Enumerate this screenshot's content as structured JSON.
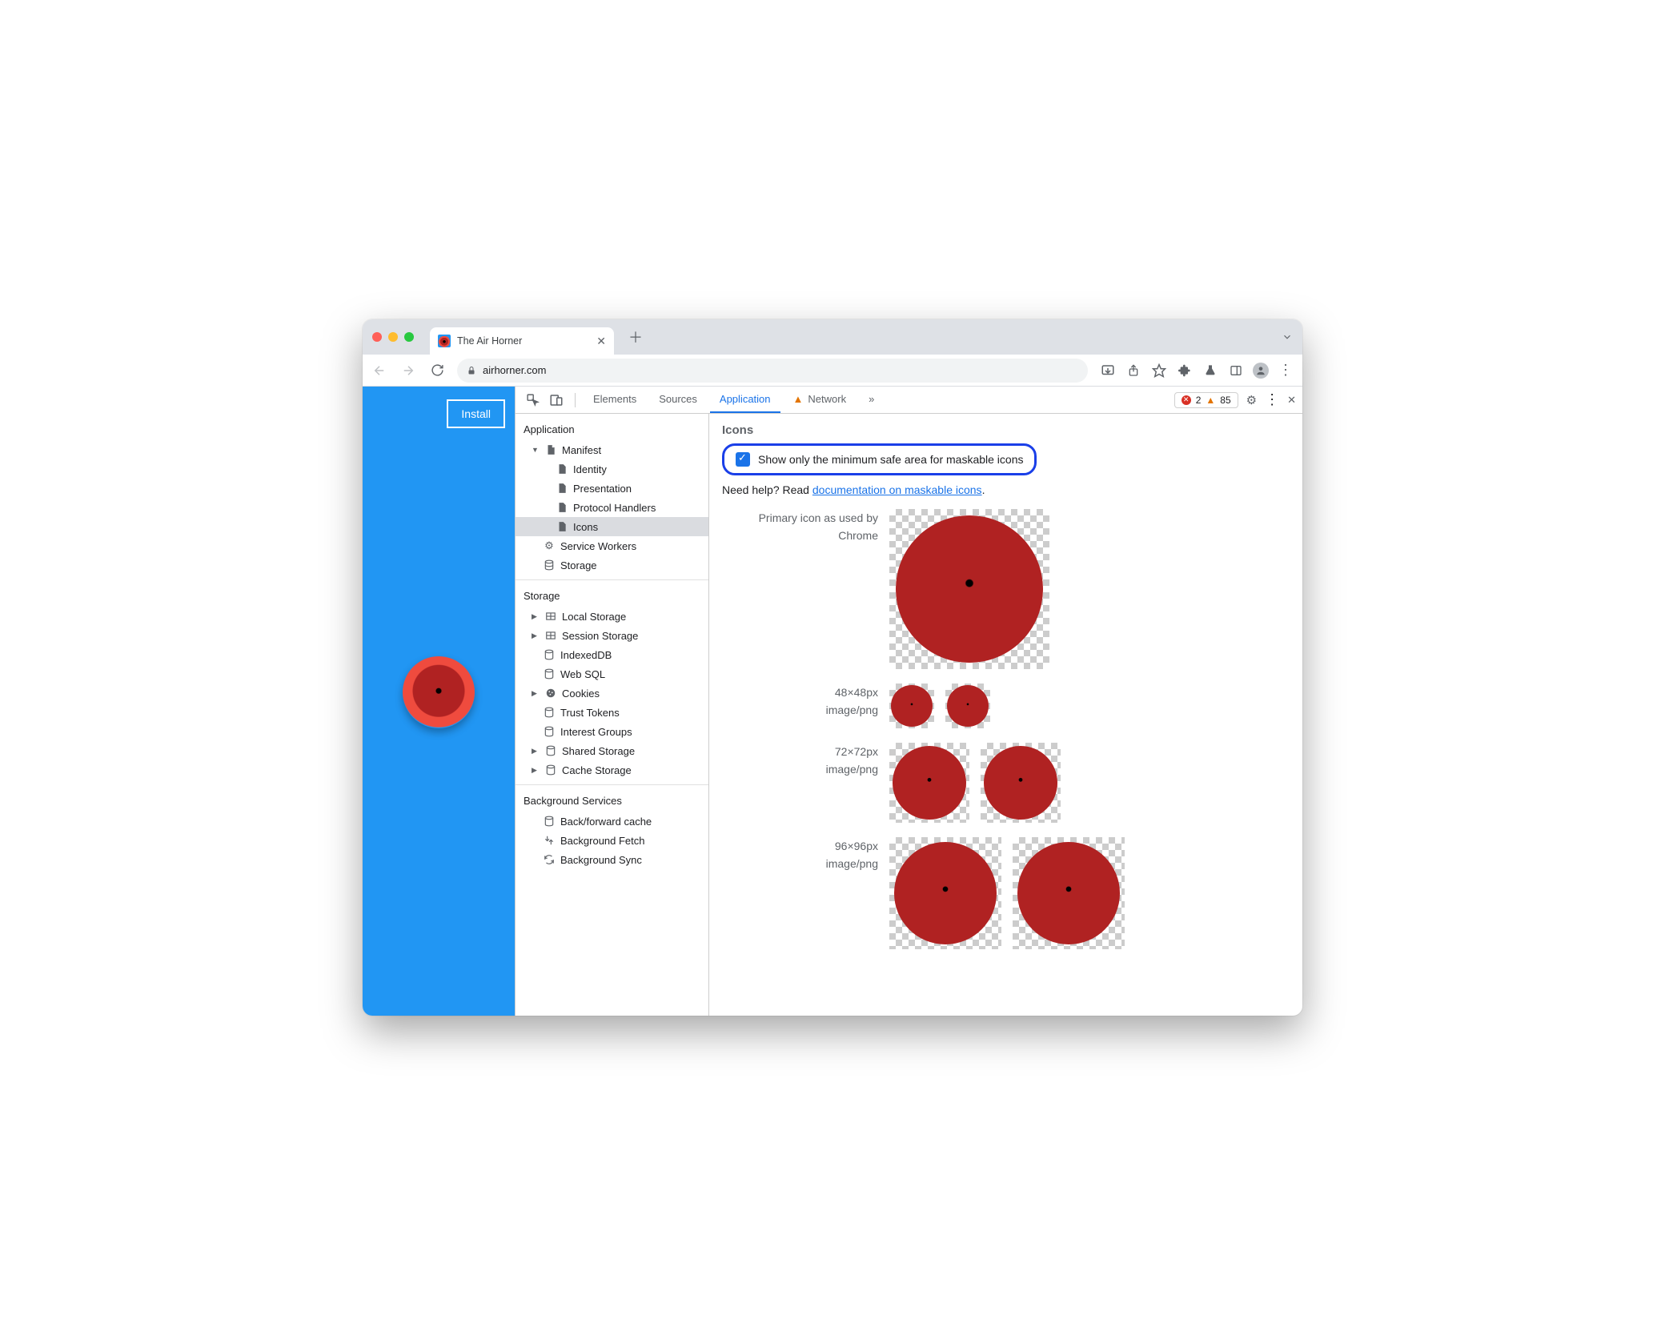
{
  "tab": {
    "title": "The Air Horner"
  },
  "omnibox": {
    "url": "airhorner.com"
  },
  "page": {
    "install_label": "Install"
  },
  "devtools": {
    "tabs": {
      "elements": "Elements",
      "sources": "Sources",
      "application": "Application",
      "network": "Network"
    },
    "counters": {
      "errors": "2",
      "warnings": "85"
    },
    "sidebar": {
      "application": {
        "heading": "Application",
        "manifest": "Manifest",
        "identity": "Identity",
        "presentation": "Presentation",
        "protocol_handlers": "Protocol Handlers",
        "icons": "Icons",
        "service_workers": "Service Workers",
        "storage_item": "Storage"
      },
      "storage": {
        "heading": "Storage",
        "local_storage": "Local Storage",
        "session_storage": "Session Storage",
        "indexeddb": "IndexedDB",
        "websql": "Web SQL",
        "cookies": "Cookies",
        "trust_tokens": "Trust Tokens",
        "interest_groups": "Interest Groups",
        "shared_storage": "Shared Storage",
        "cache_storage": "Cache Storage"
      },
      "background": {
        "heading": "Background Services",
        "bf_cache": "Back/forward cache",
        "bg_fetch": "Background Fetch",
        "bg_sync": "Background Sync"
      }
    },
    "main": {
      "heading": "Icons",
      "checkbox_label": "Show only the minimum safe area for maskable icons",
      "help_prefix": "Need help? Read ",
      "help_link": "documentation on maskable icons",
      "help_suffix": ".",
      "primary_label_1": "Primary icon as used by",
      "primary_label_2": "Chrome",
      "rows": [
        {
          "size": "48×48px",
          "mime": "image/png"
        },
        {
          "size": "72×72px",
          "mime": "image/png"
        },
        {
          "size": "96×96px",
          "mime": "image/png"
        }
      ]
    }
  }
}
